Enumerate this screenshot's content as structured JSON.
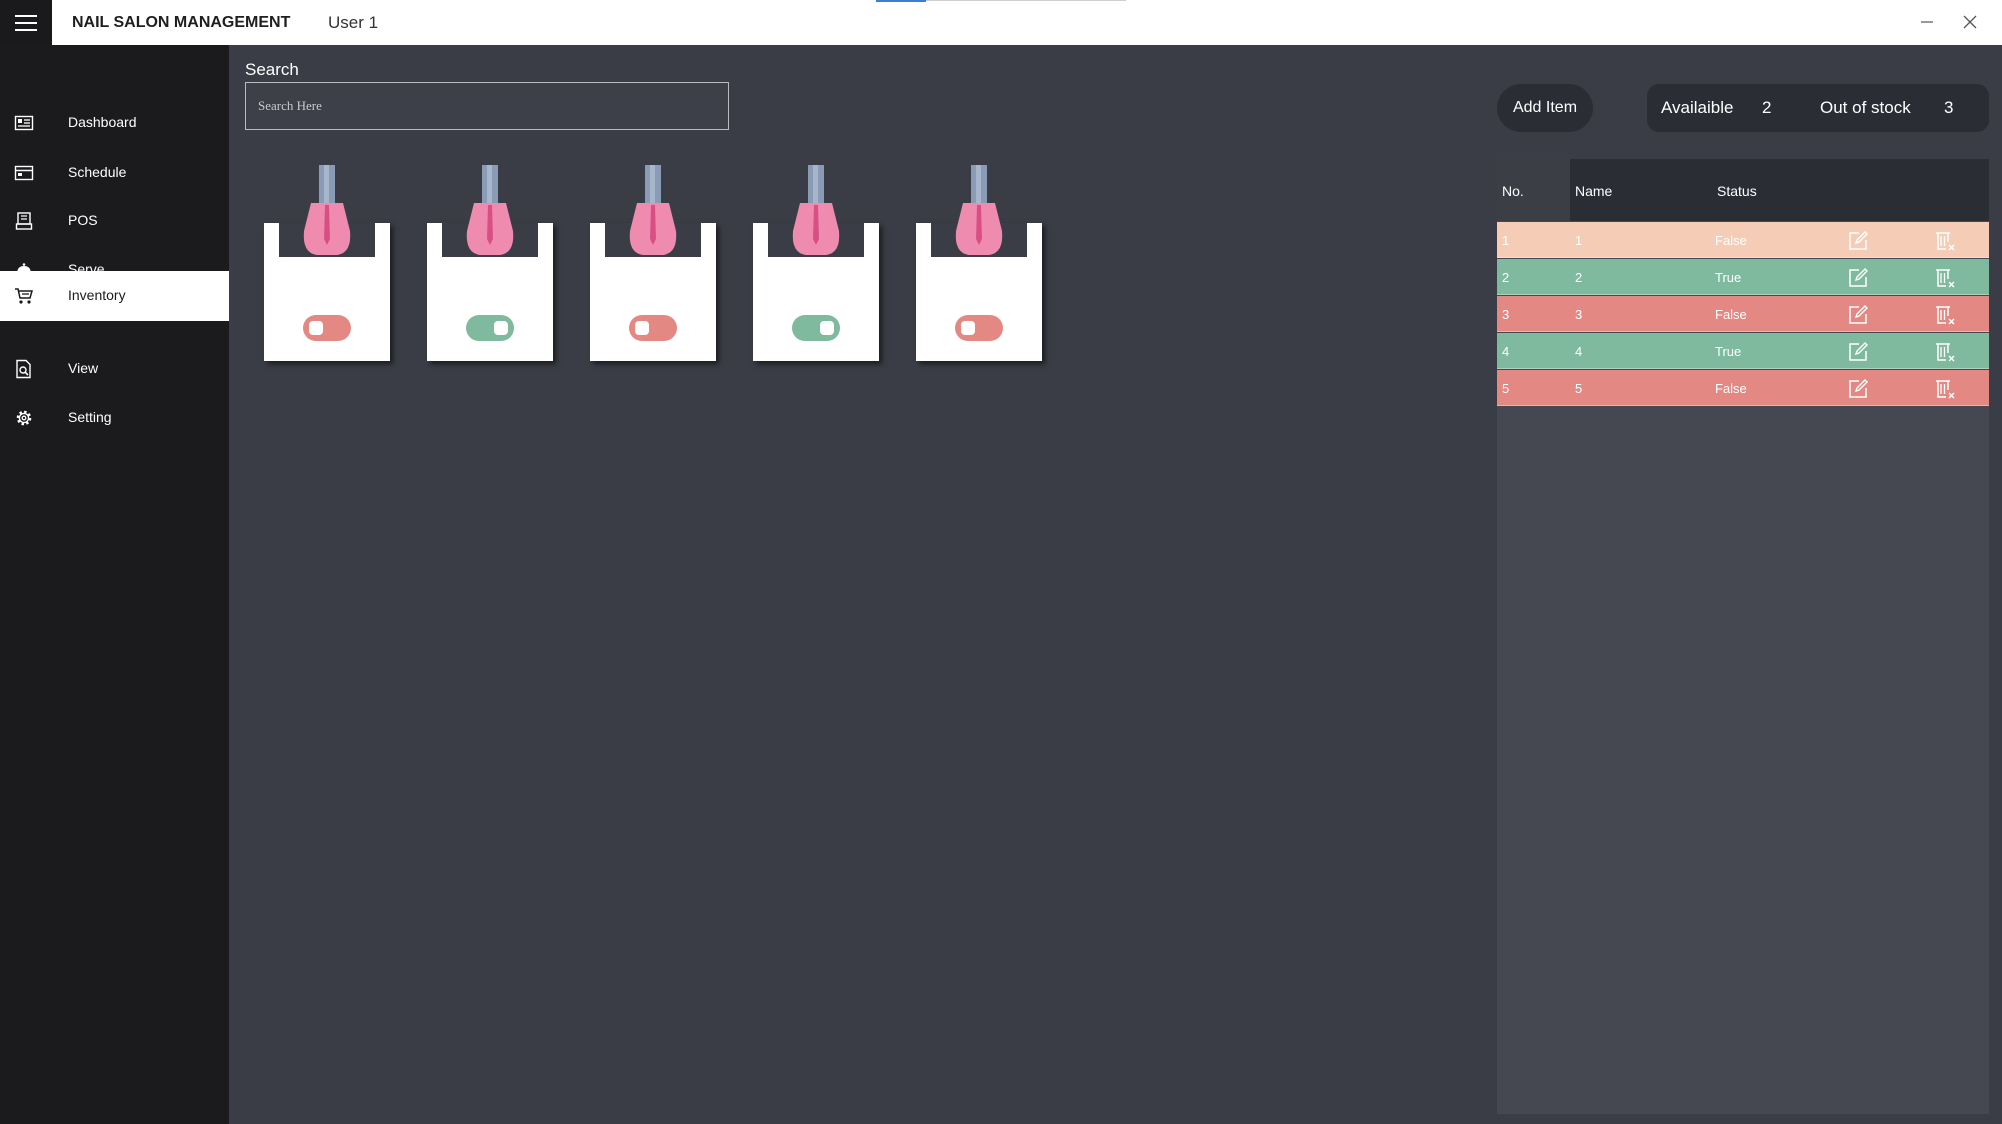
{
  "app": {
    "title": "NAIL SALON MANAGEMENT",
    "user": "User 1"
  },
  "window": {
    "minimize_icon": "minimize-icon",
    "close_icon": "close-icon"
  },
  "sidebar": {
    "items": [
      {
        "label": "Dashboard",
        "icon": "dashboard-icon",
        "active": false
      },
      {
        "label": "Schedule",
        "icon": "schedule-icon",
        "active": false
      },
      {
        "label": "POS",
        "icon": "pos-icon",
        "active": false
      },
      {
        "label": "Serve",
        "icon": "serve-bell-icon",
        "active": false
      },
      {
        "label": "Inventory",
        "icon": "cart-icon",
        "active": true
      },
      {
        "label": "View",
        "icon": "view-document-icon",
        "active": false
      },
      {
        "label": "Setting",
        "icon": "gear-icon",
        "active": false
      }
    ]
  },
  "search": {
    "label": "Search",
    "placeholder": "Search Here",
    "value": ""
  },
  "cards": [
    {
      "icon": "nail-polish-icon",
      "available": false
    },
    {
      "icon": "nail-polish-icon",
      "available": true
    },
    {
      "icon": "nail-polish-icon",
      "available": false
    },
    {
      "icon": "nail-polish-icon",
      "available": true
    },
    {
      "icon": "nail-polish-icon",
      "available": false
    }
  ],
  "toolbar": {
    "add_item_label": "Add Item",
    "available_label": "Availaible",
    "available_count": "2",
    "out_of_stock_label": "Out of stock",
    "out_of_stock_count": "3"
  },
  "table": {
    "headers": {
      "no": "No.",
      "name": "Name",
      "status": "Status"
    },
    "rows": [
      {
        "no": "1",
        "name": "1",
        "status": "False",
        "color": "#f5cdb6"
      },
      {
        "no": "2",
        "name": "2",
        "status": "True",
        "color": "#7fb99e"
      },
      {
        "no": "3",
        "name": "3",
        "status": "False",
        "color": "#e48883"
      },
      {
        "no": "4",
        "name": "4",
        "status": "True",
        "color": "#7fb99e"
      },
      {
        "no": "5",
        "name": "5",
        "status": "False",
        "color": "#e48883"
      }
    ],
    "row_actions": {
      "edit_icon": "edit-icon",
      "delete_icon": "delete-icon"
    }
  },
  "colors": {
    "toggle_on": "#7fb99e",
    "toggle_off": "#e48883",
    "polish_pink": "#f08bb0",
    "polish_cap": "#8a9bb6",
    "sidebar_bg": "#1b1b1e",
    "content_bg": "#3a3d45"
  }
}
